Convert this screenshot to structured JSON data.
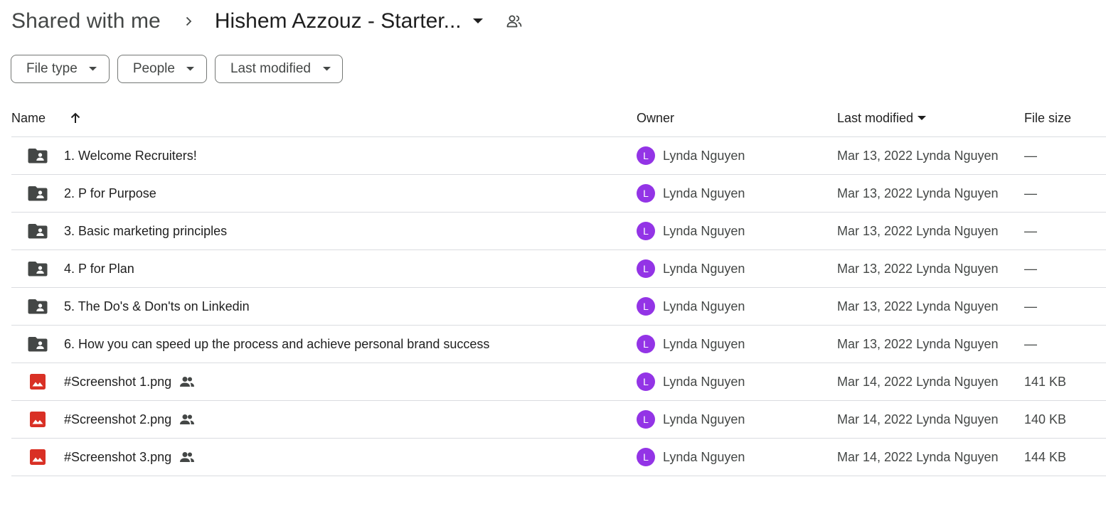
{
  "breadcrumb": {
    "root": "Shared with me",
    "current": "Hishem Azzouz - Starter..."
  },
  "filters": [
    {
      "label": "File type"
    },
    {
      "label": "People"
    },
    {
      "label": "Last modified"
    }
  ],
  "table": {
    "headers": {
      "name": "Name",
      "owner": "Owner",
      "last_modified": "Last modified",
      "file_size": "File size"
    },
    "rows": [
      {
        "type": "shared-folder",
        "name": "1. Welcome Recruiters!",
        "shared": false,
        "owner_initial": "L",
        "owner": "Lynda Nguyen",
        "modified": "Mar 13, 2022 Lynda Nguyen",
        "size": "—"
      },
      {
        "type": "shared-folder",
        "name": "2. P for Purpose",
        "shared": false,
        "owner_initial": "L",
        "owner": "Lynda Nguyen",
        "modified": "Mar 13, 2022 Lynda Nguyen",
        "size": "—"
      },
      {
        "type": "shared-folder",
        "name": "3. Basic marketing principles",
        "shared": false,
        "owner_initial": "L",
        "owner": "Lynda Nguyen",
        "modified": "Mar 13, 2022 Lynda Nguyen",
        "size": "—"
      },
      {
        "type": "shared-folder",
        "name": "4. P for Plan",
        "shared": false,
        "owner_initial": "L",
        "owner": "Lynda Nguyen",
        "modified": "Mar 13, 2022 Lynda Nguyen",
        "size": "—"
      },
      {
        "type": "shared-folder",
        "name": "5. The Do's & Don'ts on Linkedin",
        "shared": false,
        "owner_initial": "L",
        "owner": "Lynda Nguyen",
        "modified": "Mar 13, 2022 Lynda Nguyen",
        "size": "—"
      },
      {
        "type": "shared-folder",
        "name": "6. How you can speed up the process and achieve personal brand success",
        "shared": false,
        "owner_initial": "L",
        "owner": "Lynda Nguyen",
        "modified": "Mar 13, 2022 Lynda Nguyen",
        "size": "—"
      },
      {
        "type": "image",
        "name": "#Screenshot 1.png",
        "shared": true,
        "owner_initial": "L",
        "owner": "Lynda Nguyen",
        "modified": "Mar 14, 2022 Lynda Nguyen",
        "size": "141 KB"
      },
      {
        "type": "image",
        "name": "#Screenshot 2.png",
        "shared": true,
        "owner_initial": "L",
        "owner": "Lynda Nguyen",
        "modified": "Mar 14, 2022 Lynda Nguyen",
        "size": "140 KB"
      },
      {
        "type": "image",
        "name": "#Screenshot 3.png",
        "shared": true,
        "owner_initial": "L",
        "owner": "Lynda Nguyen",
        "modified": "Mar 14, 2022 Lynda Nguyen",
        "size": "144 KB"
      }
    ]
  },
  "colors": {
    "avatar": "#9334e6",
    "folder_icon": "#444746",
    "image_icon": "#d93025",
    "divider": "#dadce0"
  },
  "icons": {
    "breadcrumb_separator": "chevron-right-icon",
    "breadcrumb_caret": "caret-down-icon",
    "breadcrumb_shared": "people-outline-icon",
    "filter_caret": "caret-down-icon",
    "sort_name": "arrow-up-icon",
    "sort_modified": "caret-down-icon",
    "shared_folder": "shared-folder-icon",
    "image_file": "image-file-icon",
    "shared": "people-icon"
  }
}
